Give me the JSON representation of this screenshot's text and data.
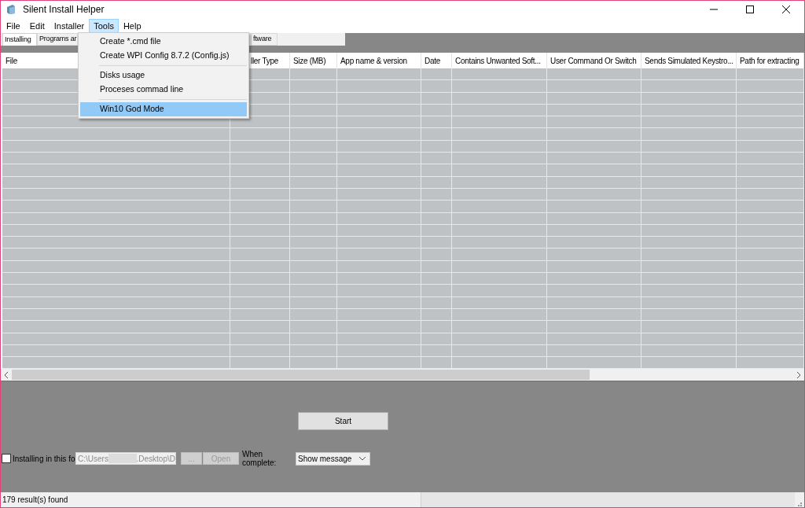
{
  "window": {
    "title": "Silent Install Helper"
  },
  "menu_bar": [
    {
      "label": "File",
      "selected": false
    },
    {
      "label": "Edit",
      "selected": false
    },
    {
      "label": "Installer",
      "selected": false
    },
    {
      "label": "Tools",
      "selected": true
    },
    {
      "label": "Help",
      "selected": false
    }
  ],
  "tools_menu": [
    {
      "kind": "item",
      "label": "Create *.cmd file",
      "selected": false
    },
    {
      "kind": "item",
      "label": "Create WPI Config 8.7.2 (Config.js)",
      "selected": false
    },
    {
      "kind": "separator"
    },
    {
      "kind": "item",
      "label": "Disks usage",
      "selected": false
    },
    {
      "kind": "item",
      "label": "Proceses commad line",
      "selected": false
    },
    {
      "kind": "separator"
    },
    {
      "kind": "item",
      "label": "Win10 God Mode",
      "selected": true
    }
  ],
  "tabs": [
    {
      "label": "Installing",
      "selected": true
    },
    {
      "label": "Programs ar",
      "selected": false
    },
    {
      "label": "ftware",
      "selected": false
    }
  ],
  "table": {
    "columns": [
      "File",
      "ller Type",
      "Size (MB)",
      "App name & version",
      "Date",
      "Contains Unwanted Soft...",
      "User Command Or Switch",
      "Sends Simulated Keystro...",
      "Path for extracting"
    ]
  },
  "start_button": "Start",
  "install_folder": {
    "label": "Installing in this fo",
    "checked": false,
    "path_start": "C:\\Users",
    "path_end": ".Desktop\\D",
    "browse_button": "...",
    "open_button": "Open",
    "buttons_disabled": true
  },
  "when_complete": {
    "label": "When complete:",
    "value": "Show message"
  },
  "status_bar": {
    "text": "179 result(s) found"
  }
}
